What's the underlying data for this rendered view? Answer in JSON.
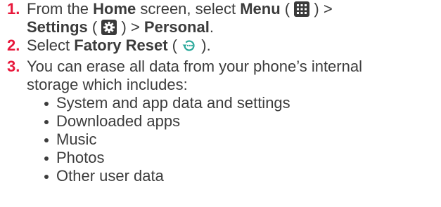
{
  "steps": [
    {
      "number": "1.",
      "parts": {
        "from": "From the ",
        "home": "Home",
        "screen_select": " screen, select ",
        "menu": "Menu",
        "menu_open": " (",
        "menu_close": ") >",
        "settings": "Settings",
        "settings_open": " (",
        "settings_close": ") > ",
        "personal": "Personal",
        "end": "."
      },
      "icons": [
        "grid-menu-icon",
        "gear-settings-icon"
      ]
    },
    {
      "number": "2.",
      "parts": {
        "select": "Select ",
        "reset": "Fatory Reset",
        "open": " (",
        "close": ")."
      },
      "icons": [
        "factory-reset-icon"
      ]
    },
    {
      "number": "3.",
      "line1": "You can erase all data from your phone’s internal",
      "line2": "storage which includes:"
    }
  ],
  "bullets": [
    "System and app data and settings",
    "Downloaded apps",
    "Music",
    "Photos",
    "Other user data"
  ],
  "colors": {
    "number": "#e8173a",
    "text": "#3c3c3c",
    "icon_bg": "#3a3a3a",
    "reset_icon": "#2aa89a"
  }
}
